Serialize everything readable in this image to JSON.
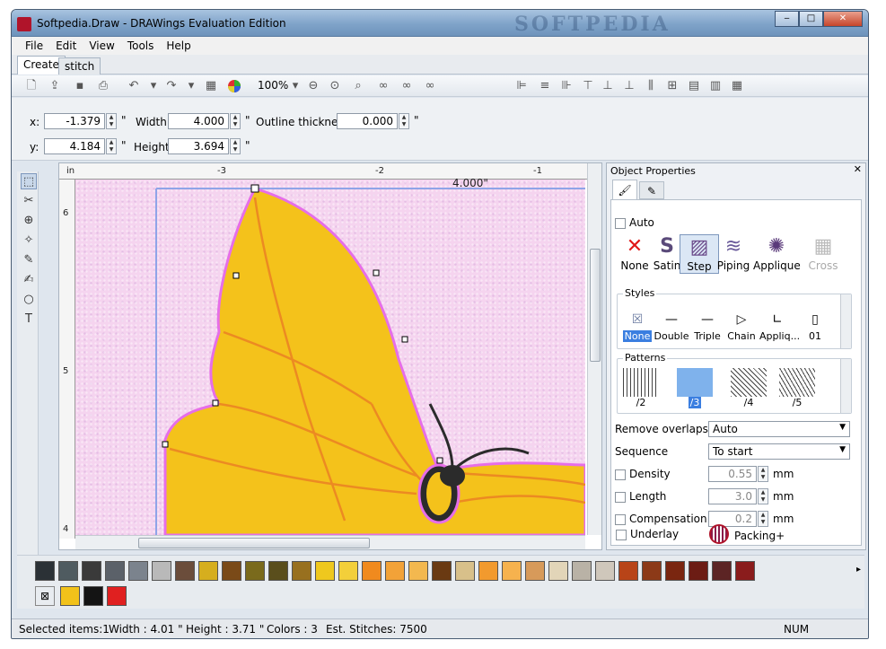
{
  "window": {
    "title": "Softpedia.Draw - DRAWings Evaluation Edition",
    "watermark": "SOFTPEDIA",
    "minimize": "‒",
    "maximize": "□",
    "close": "✕"
  },
  "menu": [
    "File",
    "Edit",
    "View",
    "Tools",
    "Help"
  ],
  "tabs": [
    {
      "label": "Create"
    },
    {
      "label": "stitch"
    }
  ],
  "toolbar": {
    "zoom": "100%"
  },
  "object_props": {
    "x_label": "x:",
    "x_value": "-1.379",
    "x_unit": "\"",
    "y_label": "y:",
    "y_value": "4.184",
    "y_unit": "\"",
    "width_label": "Width:",
    "width_value": "4.000",
    "width_unit": "\"",
    "height_label": "Height:",
    "height_value": "3.694",
    "height_unit": "\"",
    "outline_label": "Outline thickness:",
    "outline_value": "0.000",
    "outline_unit": "\""
  },
  "canvas": {
    "ruler_unit": "in",
    "ruler_top_labels": [
      "-3",
      "-2",
      "-1"
    ],
    "ruler_left_labels": [
      "6",
      "5",
      "4"
    ],
    "width_readout": "4.000\""
  },
  "panel": {
    "title": "Object Properties",
    "close": "✕",
    "auto_label": "Auto",
    "fill_types": [
      "None",
      "Satin",
      "Step",
      "Piping",
      "Applique",
      "Cross"
    ],
    "styles_title": "Styles",
    "styles": [
      "None",
      "Double",
      "Triple",
      "Chain",
      "Appliq...",
      "01"
    ],
    "patterns_title": "Patterns",
    "patterns": [
      "/2",
      "/3",
      "/4",
      "/5"
    ],
    "remove_overlaps_label": "Remove overlaps",
    "remove_overlaps_value": "Auto",
    "sequence_label": "Sequence",
    "sequence_value": "To start",
    "density_label": "Density",
    "density_value": "0.55",
    "density_unit": "mm",
    "length_label": "Length",
    "length_value": "3.0",
    "length_unit": "mm",
    "compensation_label": "Compensation",
    "compensation_value": "0.2",
    "compensation_unit": "mm",
    "underlay_label": "Underlay",
    "packing_label": "Packing+"
  },
  "palette": {
    "colors": [
      "#2b3136",
      "#4f5b60",
      "#3a3a3a",
      "#5b6169",
      "#7b838d",
      "#b9b9b9",
      "#6b4d3b",
      "#d6ae1e",
      "#7a4a18",
      "#7a6a1c",
      "#5a4e1c",
      "#98701f",
      "#efc81e",
      "#f3cf3a",
      "#f08a1e",
      "#f2a238",
      "#f3b84f",
      "#6a3a12",
      "#d8c08a",
      "#f29a2e",
      "#f6b24e",
      "#d79a5a",
      "#e2d5b8",
      "#b9b2a6",
      "#cfc7bb",
      "#b84418",
      "#8c3a18",
      "#7a2610",
      "#6c1c14",
      "#5c2424",
      "#8a1c1c"
    ],
    "recent": [
      "#f2c21a",
      "#141414",
      "#e02020"
    ]
  },
  "status": {
    "selected": "Selected items:1",
    "width": "Width : 4.01 \"",
    "height": "Height : 3.71 \"",
    "colors": "Colors : 3",
    "stitches": "Est. Stitches: 7500",
    "num": "NUM"
  }
}
